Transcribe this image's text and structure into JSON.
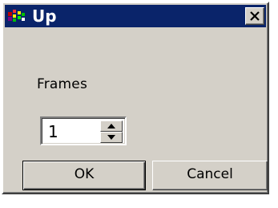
{
  "dialog": {
    "title": "Up",
    "app_icon": "app-icon",
    "close_icon": "close-icon"
  },
  "frames": {
    "label": "Frames",
    "value": "1",
    "up_icon": "spin-up-arrow-icon",
    "down_icon": "spin-down-arrow-icon"
  },
  "buttons": {
    "ok_label": "OK",
    "cancel_label": "Cancel"
  },
  "colors": {
    "titlebar": "#0a246a",
    "face": "#d4d0c8",
    "title_text": "#ffffff"
  }
}
